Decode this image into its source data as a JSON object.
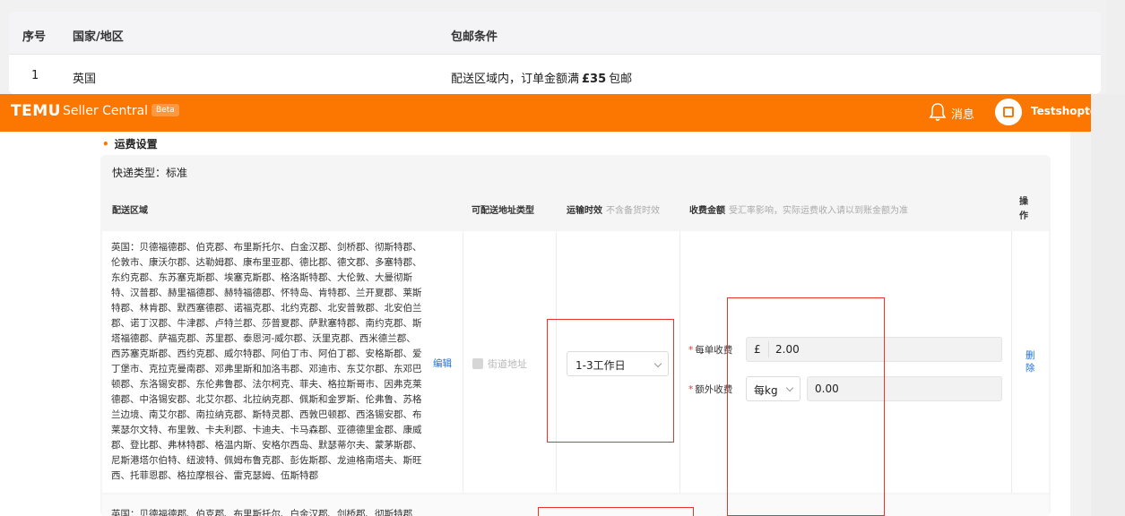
{
  "top_table": {
    "headers": {
      "index": "序号",
      "country": "国家/地区",
      "condition": "包邮条件"
    },
    "row": {
      "index": "1",
      "country": "英国",
      "cond_prefix": "配送区域内，订单金额满",
      "cond_amount": "£35",
      "cond_suffix": "包邮"
    }
  },
  "topbar": {
    "logo": "TEMU",
    "product": "Seller Central",
    "badge": "Beta",
    "messages_label": "消息",
    "user": "Testshopteam",
    "brand_color": "#fb7701"
  },
  "section": {
    "title": "运费设置",
    "express_type": "快递类型：标准"
  },
  "columns": {
    "region": "配送区域",
    "address_type": "可配送地址类型",
    "transit": "运输时效",
    "transit_note": "不含备货时效",
    "fee": "收费金额",
    "fee_note": "受汇率影响，实际运费收入请以到账金额为准",
    "action": "操作"
  },
  "row": {
    "region_text": "英国：贝德福德郡、伯克郡、布里斯托尔、白金汉郡、剑桥郡、彻斯特郡、伦敦市、康沃尔郡、达勒姆郡、康布里亚郡、德比郡、德文郡、多塞特郡、东约克郡、东苏塞克斯郡、埃塞克斯郡、格洛斯特郡、大伦敦、大曼彻斯特、汉普郡、赫里福德郡、赫特福德郡、怀特岛、肯特郡、兰开夏郡、莱斯特郡、林肯郡、默西塞德郡、诺福克郡、北约克郡、北安普敦郡、北安伯兰郡、诺丁汉郡、牛津郡、卢特兰郡、莎普夏郡、萨默塞特郡、南约克郡、斯塔福德郡、萨福克郡、苏里郡、泰恩河-威尔郡、沃里克郡、西米德兰郡、西苏塞克斯郡、西约克郡、威尔特郡、阿伯丁市、阿伯丁郡、安格斯郡、爱丁堡市、克拉克曼南郡、邓弗里斯和加洛韦郡、邓迪市、东艾尔郡、东邓巴顿郡、东洛锡安郡、东伦弗鲁郡、法尔柯克、菲夫、格拉斯哥市、因弗克莱德郡、中洛锡安郡、北艾尔郡、北拉纳克郡、佩斯和金罗斯、伦弗鲁、苏格兰边境、南艾尔郡、南拉纳克郡、斯特灵郡、西敦巴顿郡、西洛锡安郡、布莱瑟尔文特、布里敦、卡夫利郡、卡迪夫、卡马森郡、亚德德里金郡、康威郡、登比郡、弗林特郡、格温内斯、安格尔西岛、默瑟蒂尔夫、蒙茅斯郡、尼斯港塔尔伯特、纽波特、佩姆布鲁克郡、彭佐斯郡、龙迪格南塔夫、斯旺西、托菲恩郡、格拉摩根谷、雷克瑟姆、伍斯特郡",
    "edit_label": "编辑",
    "address_type_value": "街道地址",
    "transit_value": "1-3工作日",
    "per_order_label": "每单收费",
    "currency_symbol": "£",
    "per_order_value": "2.00",
    "extra_label": "额外收费",
    "extra_unit": "每kg",
    "extra_value": "0.00",
    "delete_label": "删除"
  },
  "next_row_text": "英国：贝德福德郡、伯克郡、布里斯托尔、白金汉郡、剑桥郡、彻斯特郡"
}
